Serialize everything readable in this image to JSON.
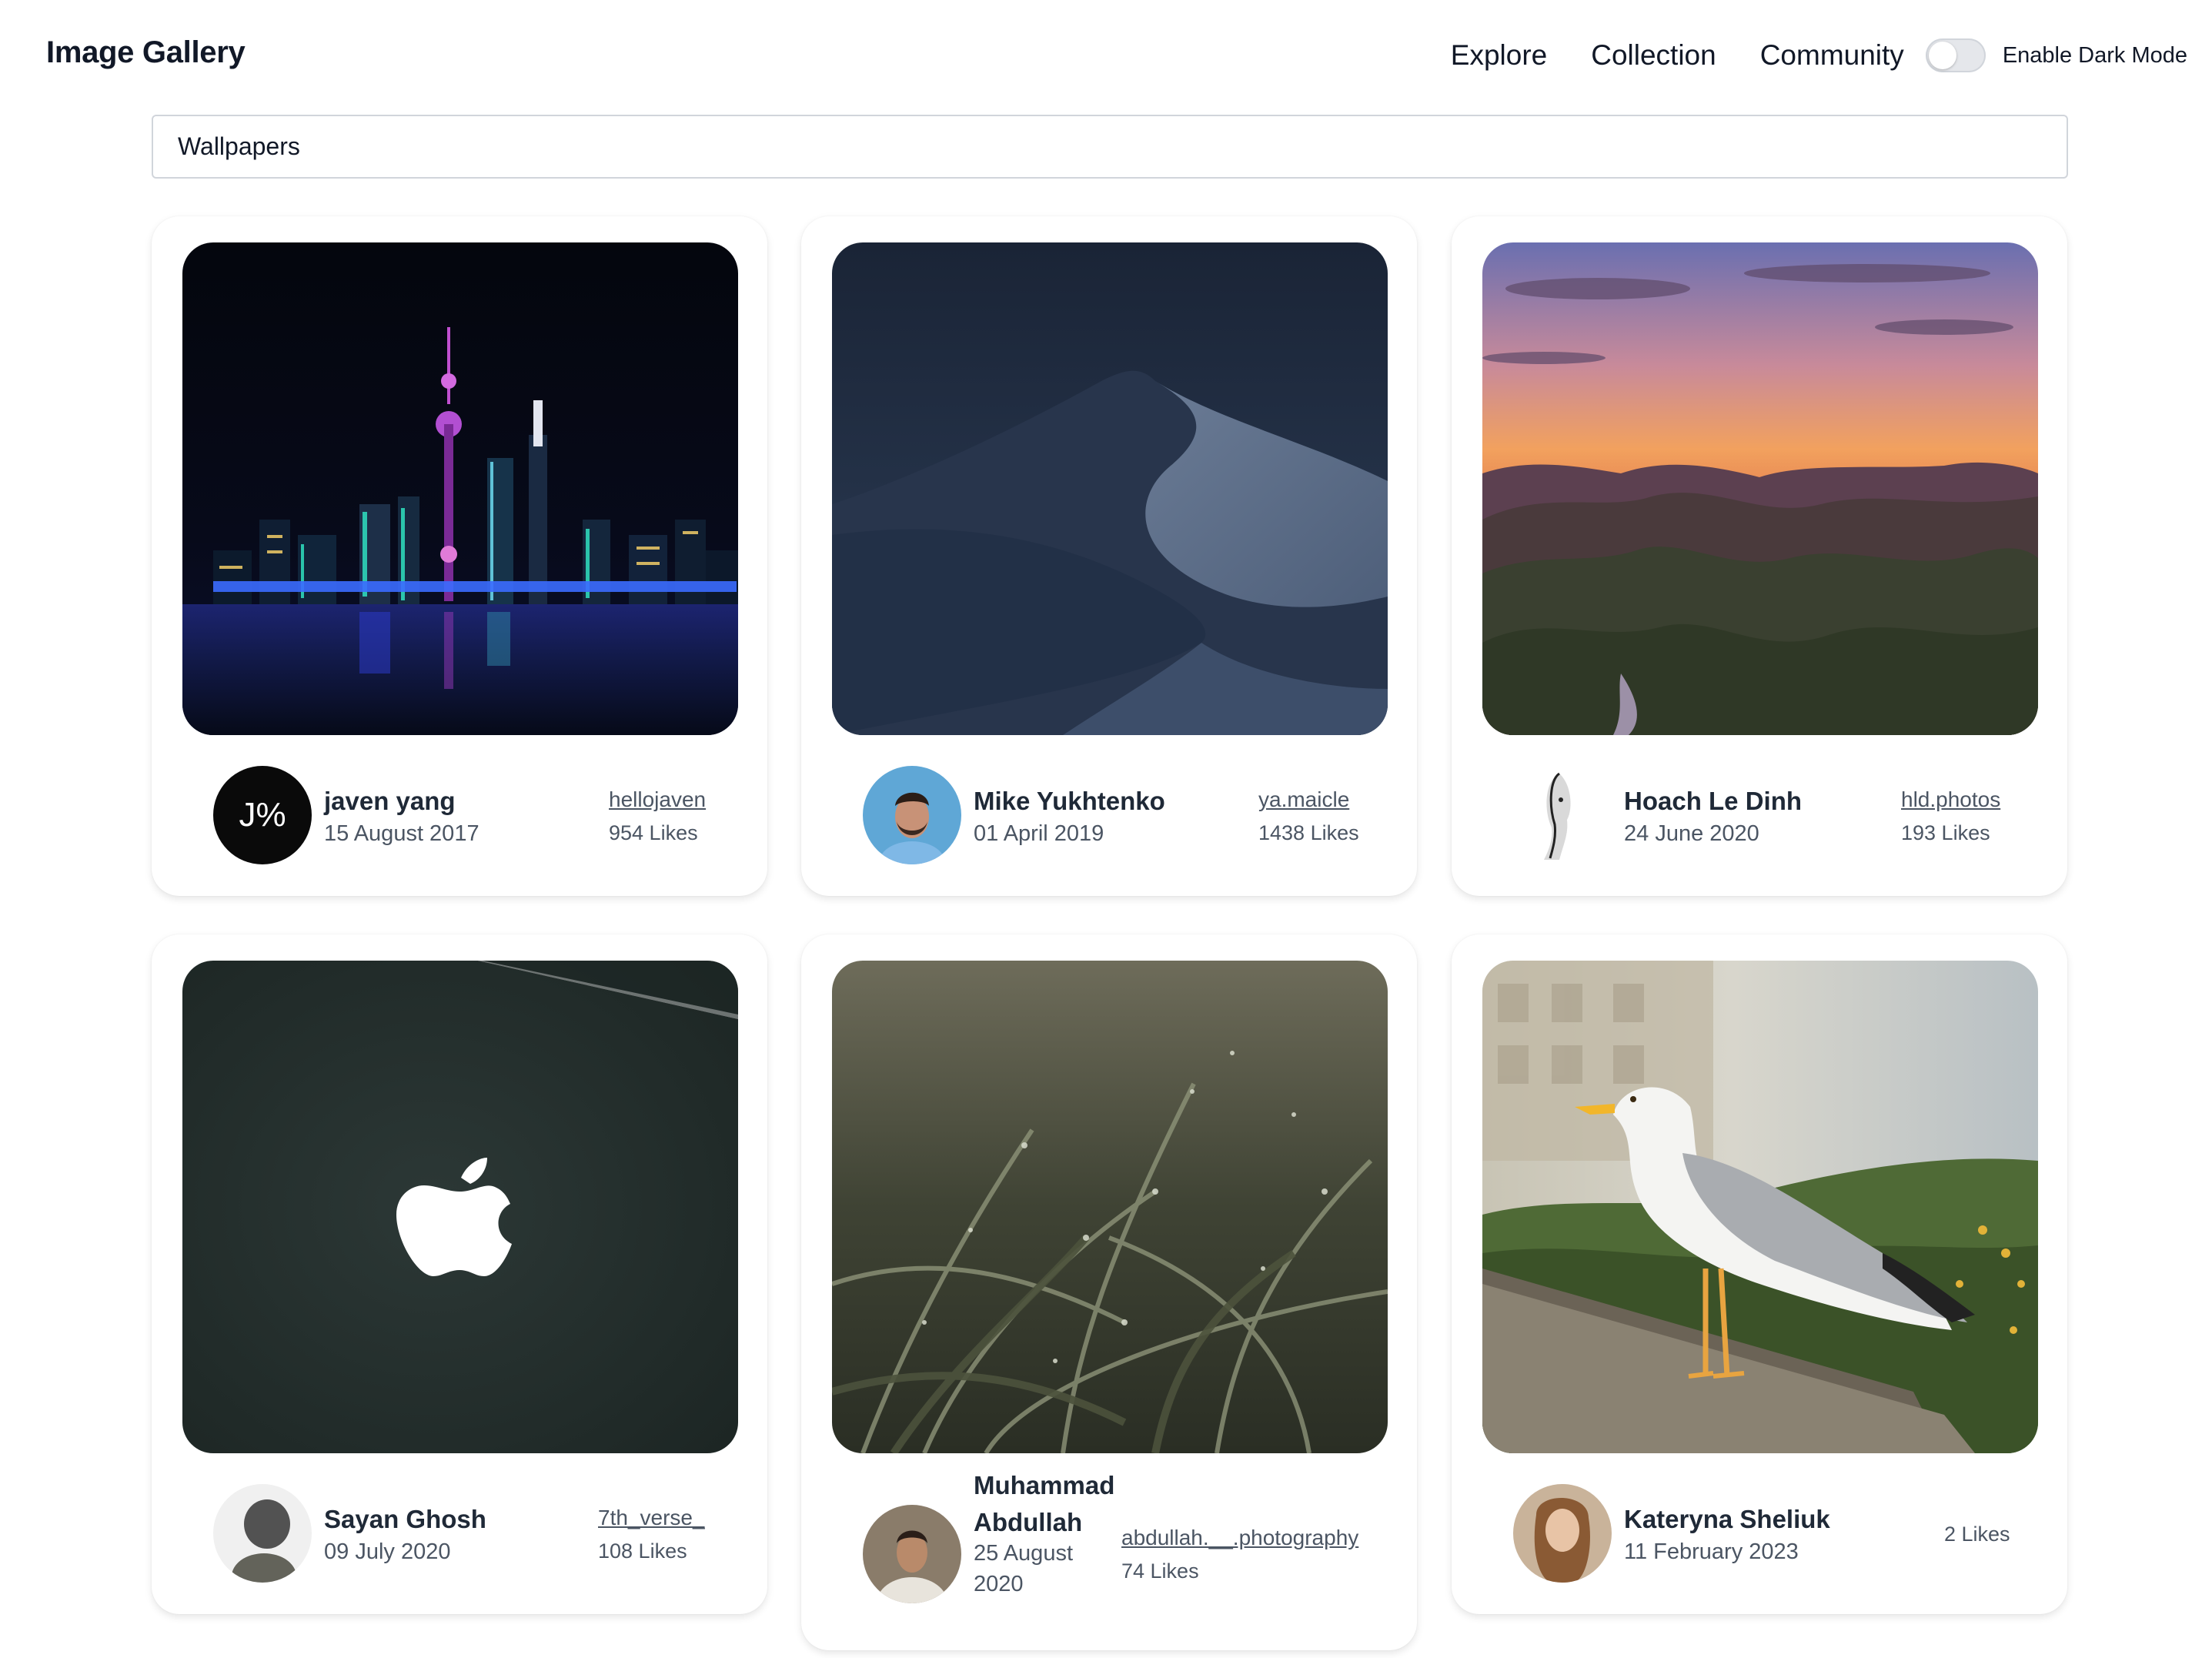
{
  "header": {
    "brand": "Image Gallery",
    "nav": [
      "Explore",
      "Collection",
      "Community"
    ],
    "dark_mode_label": "Enable Dark Mode",
    "dark_mode_enabled": false
  },
  "search": {
    "value": "Wallpapers",
    "placeholder": ""
  },
  "cards": [
    {
      "author": "javen yang",
      "date": "15 August 2017",
      "handle": "hellojaven",
      "likes": "954 Likes",
      "photo": "city-skyline-night-photo",
      "avatar": "j-percent-logo-avatar",
      "avatar_text": "J%"
    },
    {
      "author": "Mike Yukhtenko",
      "date": "01 April 2019",
      "handle": "ya.maicle",
      "likes": "1438 Likes",
      "photo": "desert-dune-photo",
      "avatar": "bearded-man-avatar"
    },
    {
      "author": "Hoach Le Dinh",
      "date": "24 June 2020",
      "handle": "hld.photos",
      "likes": "193 Likes",
      "photo": "sunset-islands-photo",
      "avatar": "face-sketch-avatar"
    },
    {
      "author": "Sayan Ghosh",
      "date": "09 July 2020",
      "handle": "7th_verse_",
      "likes": "108 Likes",
      "photo": "apple-logo-laptop-photo",
      "avatar": "blurred-person-avatar"
    },
    {
      "author": "Muhammad Abdullah",
      "author_line1": "Muhammad",
      "author_line2": "Abdullah",
      "date": "25 August 2020",
      "date_line1": "25 August",
      "date_line2": "2020",
      "handle": "abdullah.__.photography",
      "likes": "74 Likes",
      "photo": "wet-grass-photo",
      "avatar": "young-man-avatar"
    },
    {
      "author": "Kateryna Sheliuk",
      "date": "11 February 2023",
      "handle": "",
      "likes": "2 Likes",
      "photo": "seagull-photo",
      "avatar": "woman-portrait-avatar"
    }
  ]
}
